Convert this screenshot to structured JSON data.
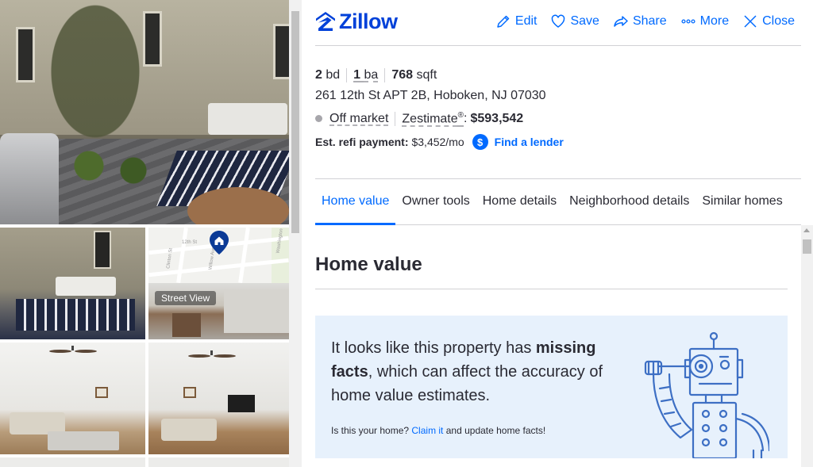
{
  "brand": {
    "name": "Zillow",
    "logo_color": "#0041d9",
    "accent": "#006aff"
  },
  "header": {
    "actions": [
      {
        "label": "Edit",
        "icon": "pencil-icon"
      },
      {
        "label": "Save",
        "icon": "heart-icon"
      },
      {
        "label": "Share",
        "icon": "share-icon"
      },
      {
        "label": "More",
        "icon": "more-dots-icon"
      },
      {
        "label": "Close",
        "icon": "close-icon"
      }
    ]
  },
  "photos": {
    "street_view_label": "Street View",
    "map_streets": [
      "12th St",
      "Willow Ave",
      "Clinton St",
      "Washington"
    ]
  },
  "summary": {
    "beds_value": "2",
    "beds_unit": "bd",
    "baths_value": "1",
    "baths_unit": "ba",
    "sqft_value": "768",
    "sqft_unit": "sqft",
    "address": "261 12th St APT 2B, Hoboken, NJ 07030",
    "status": "Off market",
    "status_color": "#a7a6ab",
    "zestimate_label": "Zestimate",
    "zestimate_mark": "®",
    "zestimate_sep": ":",
    "zestimate_value": "$593,542",
    "refi_label": "Est. refi payment:",
    "refi_value": "$3,452/mo",
    "lender_icon_text": "$",
    "lender_link": "Find a lender"
  },
  "tabs": [
    {
      "label": "Home value",
      "active": true
    },
    {
      "label": "Owner tools",
      "active": false
    },
    {
      "label": "Home details",
      "active": false
    },
    {
      "label": "Neighborhood details",
      "active": false
    },
    {
      "label": "Similar homes",
      "active": false
    }
  ],
  "home_value": {
    "title": "Home value",
    "notice_pre": "It looks like this property has ",
    "notice_bold": "missing facts",
    "notice_post": ", which can affect the accuracy of home value estimates.",
    "sub_pre": "Is this your home? ",
    "sub_link": "Claim it",
    "sub_post": " and update home facts!",
    "notice_bg": "#e7f1fc"
  }
}
